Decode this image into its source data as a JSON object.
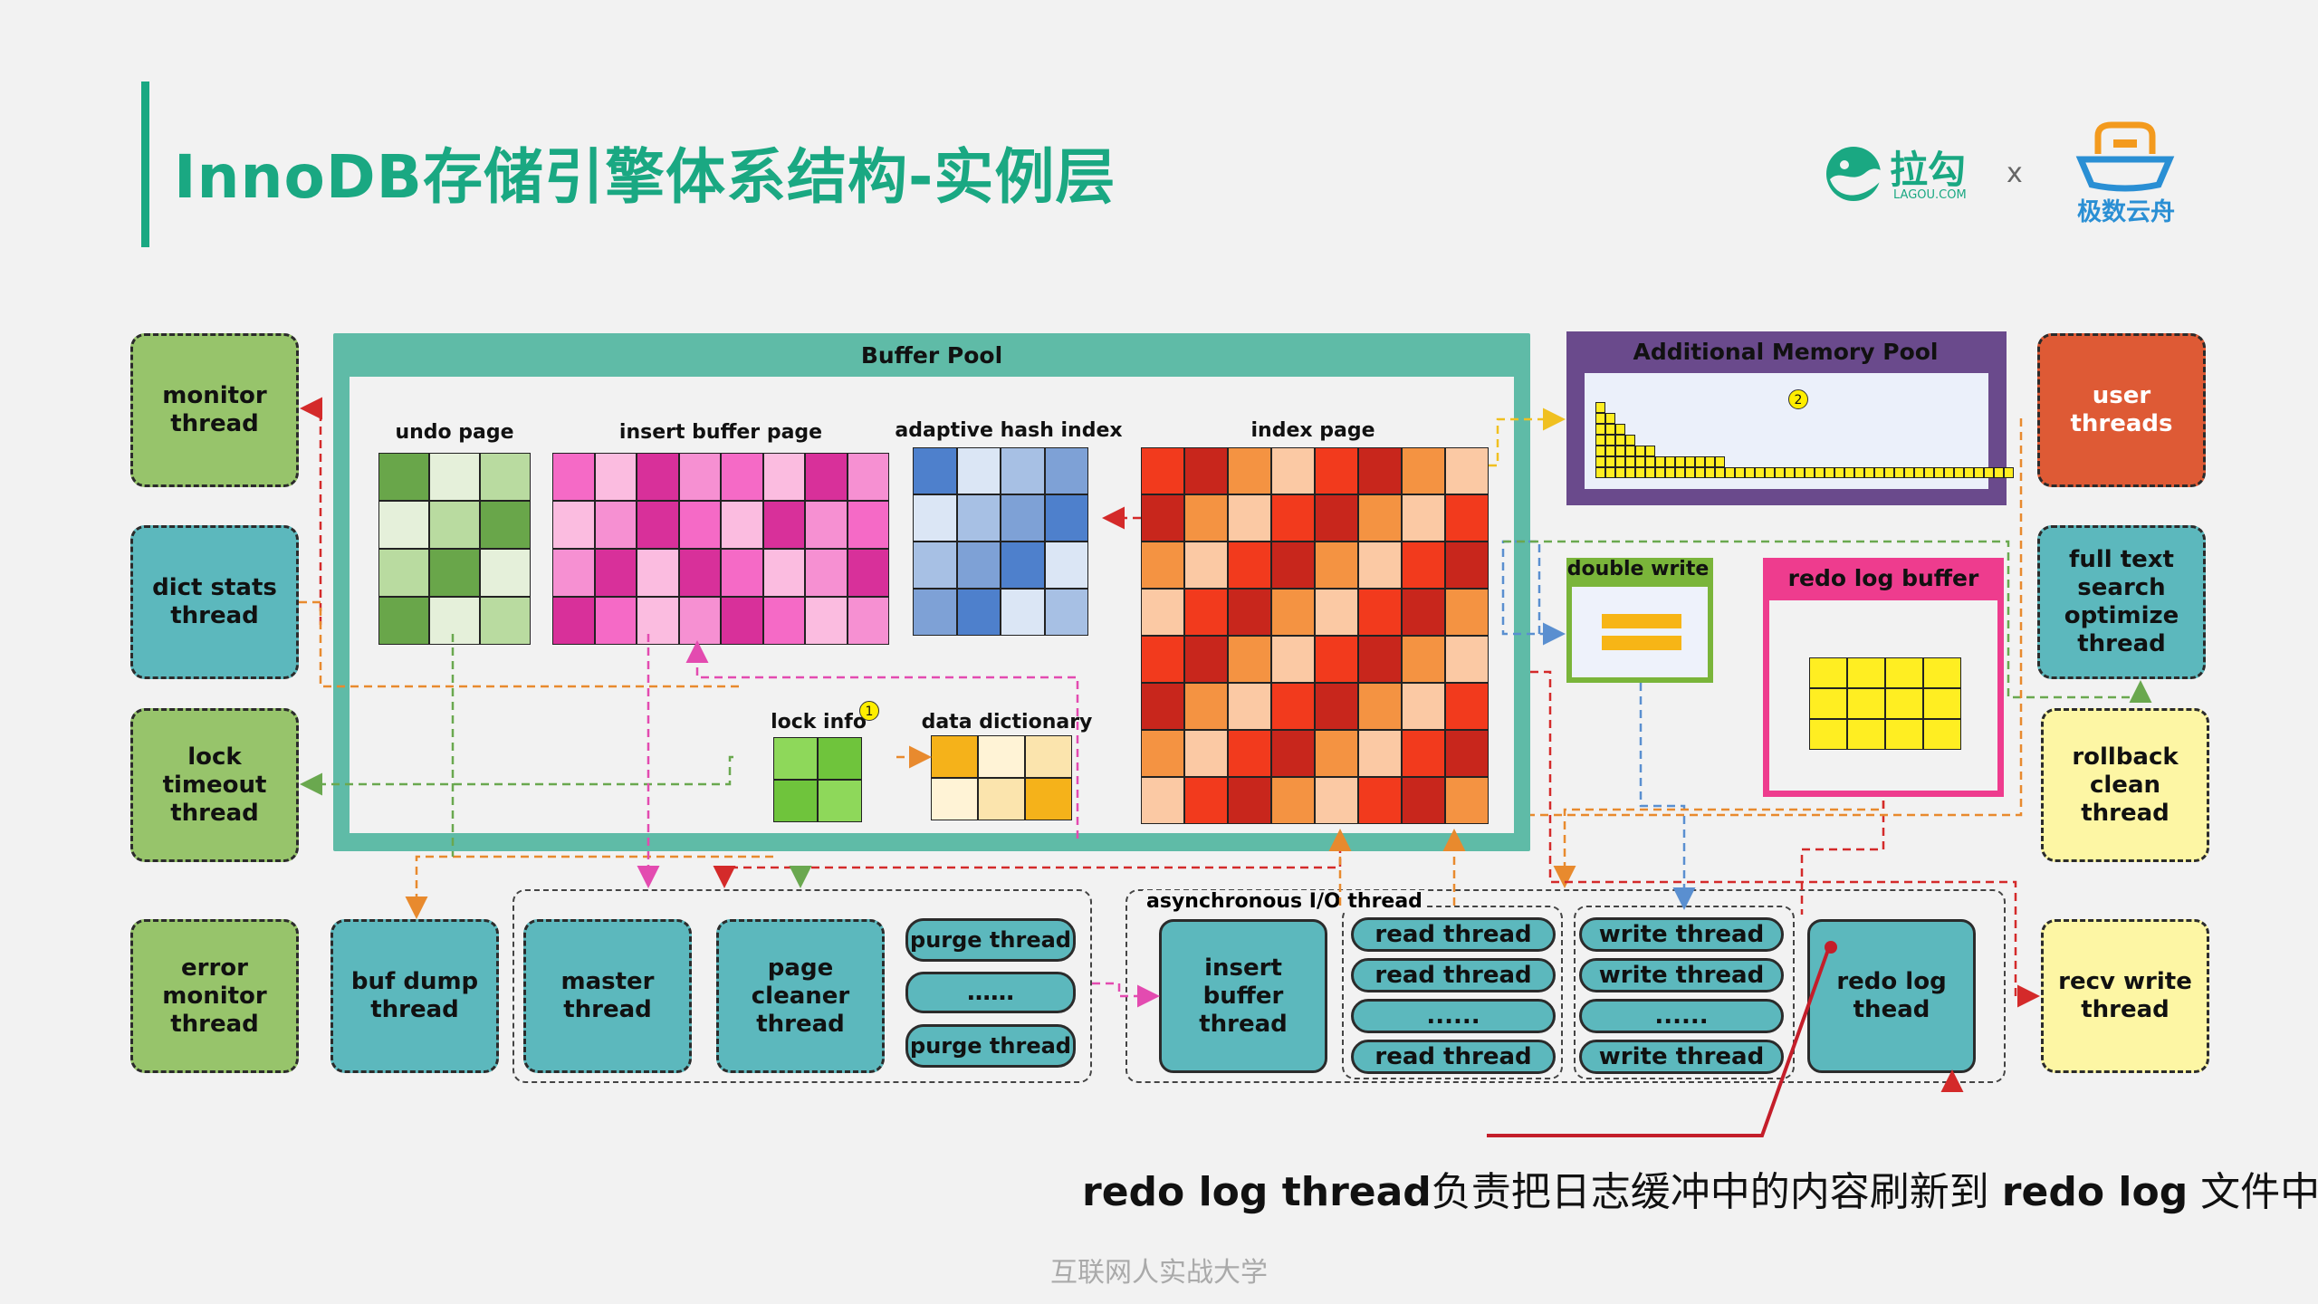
{
  "title": "InnoDB存储引擎体系结构-实例层",
  "logos": {
    "lagou_name": "拉勾",
    "lagou_sub": "LAGOU.COM",
    "separator": "x",
    "jishu_name": "极数云舟"
  },
  "threads_left": {
    "monitor": "monitor thread",
    "dict_stats": "dict stats thread",
    "lock_timeout": "lock timeout thread",
    "error_monitor": "error monitor thread"
  },
  "threads_right": {
    "user": "user threads",
    "full_text": "full text search optimize thread",
    "rollback": "rollback clean thread",
    "recv_write": "recv write thread"
  },
  "bottom": {
    "buf_dump": "buf dump thread",
    "master": "master thread",
    "page_cleaner": "page cleaner thread",
    "purge_1": "purge thread",
    "purge_dots": "……",
    "purge_2": "purge thread",
    "async_label": "asynchronous I/O thread",
    "insert_buffer": "insert buffer thread",
    "read_1": "read thread",
    "read_2": "read thread",
    "read_dots": "......",
    "read_3": "read thread",
    "write_1": "write thread",
    "write_2": "write thread",
    "write_dots": "......",
    "write_3": "write thread",
    "redo_log": "redo log thead"
  },
  "buffer_pool": {
    "title": "Buffer Pool",
    "undo_page": "undo page",
    "insert_buffer_page": "insert buffer page",
    "adaptive_hash_index": "adaptive hash index",
    "index_page": "index page",
    "lock_info": "lock info",
    "lock_badge": "1",
    "data_dictionary": "data dictionary"
  },
  "additional_memory_pool": {
    "title": "Additional Memory Pool",
    "badge": "2"
  },
  "double_write": {
    "title": "double write"
  },
  "redo_log_buffer": {
    "title": "redo log buffer"
  },
  "caption": {
    "part1": "redo log thread",
    "part2": "负责把日志缓冲中的内容刷新到 ",
    "part3": "redo log",
    "part4": " 文件中"
  },
  "footer": "互联网人实战大学",
  "colors": {
    "brand_green": "#1aa882",
    "thread_green": "#97c46b",
    "thread_teal": "#5cb8bd",
    "thread_red": "#de5a35",
    "thread_yellow": "#fdf6a4",
    "buffer_pool_border": "#5fbba7",
    "memory_pool_border": "#6a4a8c",
    "redo_buffer_border": "#ee3c8e",
    "double_write_border": "#7ab53a"
  }
}
